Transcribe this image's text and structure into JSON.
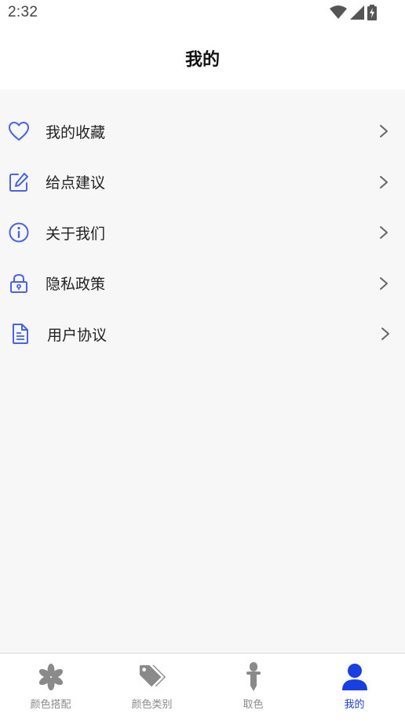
{
  "status_bar": {
    "time": "2:32"
  },
  "header": {
    "title": "我的"
  },
  "menu": [
    {
      "label": "我的收藏",
      "icon": "heart-icon"
    },
    {
      "label": "给点建议",
      "icon": "edit-icon"
    },
    {
      "label": "关于我们",
      "icon": "info-icon"
    },
    {
      "label": "隐私政策",
      "icon": "lock-icon"
    },
    {
      "label": "用户协议",
      "icon": "document-icon"
    }
  ],
  "bottom_nav": [
    {
      "label": "颜色搭配",
      "icon": "asterisk-icon",
      "active": false
    },
    {
      "label": "颜色类别",
      "icon": "tag-icon",
      "active": false
    },
    {
      "label": "取色",
      "icon": "dropper-icon",
      "active": false
    },
    {
      "label": "我的",
      "icon": "user-icon",
      "active": true
    }
  ],
  "colors": {
    "accent": "#1a3fe0",
    "icon_blue": "#4a63e6",
    "inactive": "#8a8a8a"
  }
}
